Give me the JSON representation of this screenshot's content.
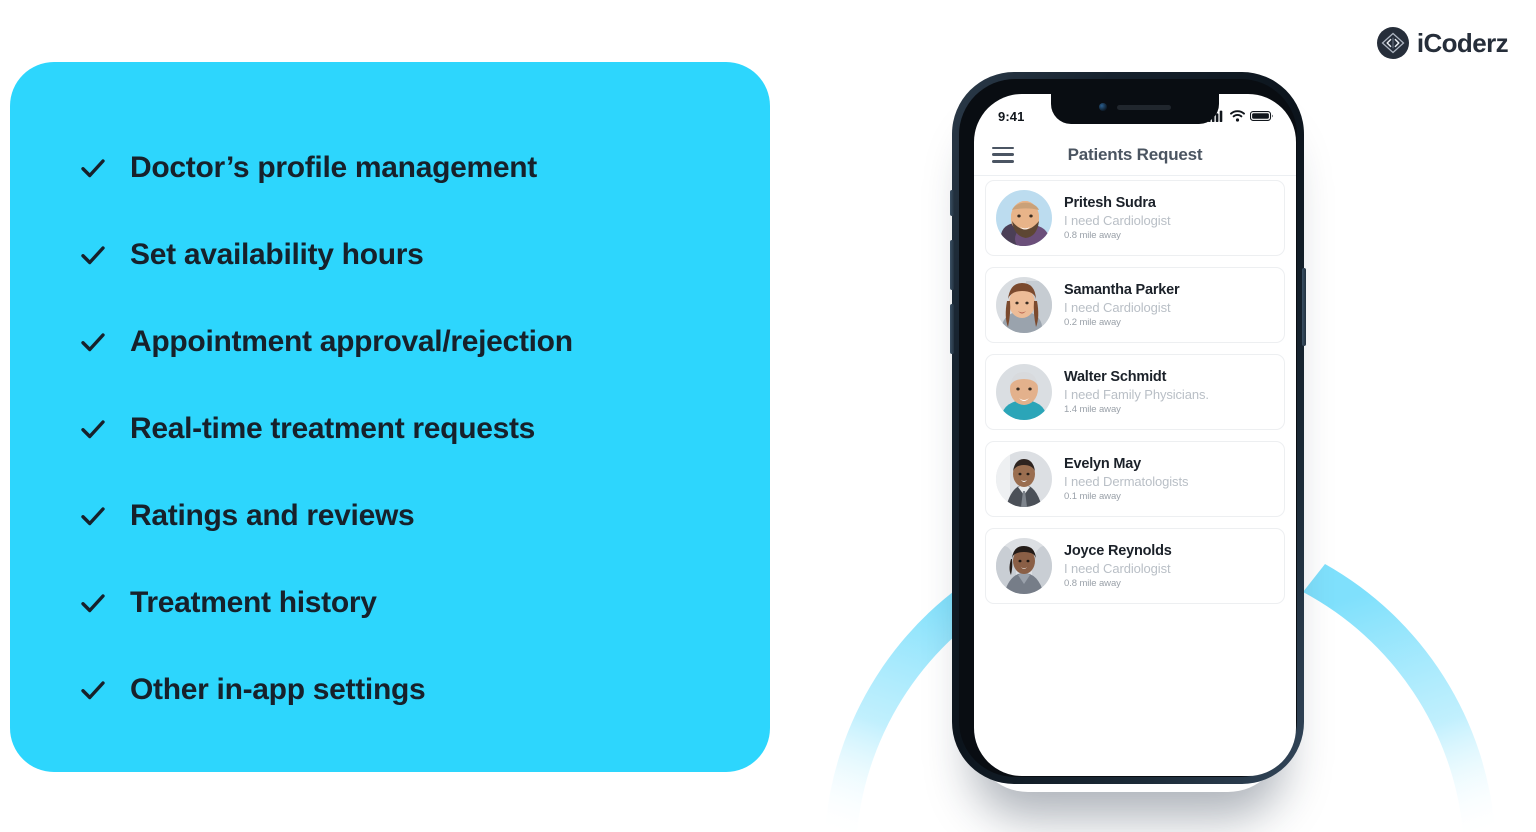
{
  "brand": {
    "name": "iCoderz",
    "mark_icon": "icoderz-diamond-icon",
    "color": "#262e3a"
  },
  "features_panel": {
    "background_color": "#2DD6FD",
    "text_color": "#17212b",
    "check_icon": "check-icon",
    "items": [
      {
        "label": "Doctor’s profile management"
      },
      {
        "label": "Set availability hours"
      },
      {
        "label": "Appointment approval/rejection"
      },
      {
        "label": "Real-time treatment requests"
      },
      {
        "label": "Ratings and reviews"
      },
      {
        "label": "Treatment history"
      },
      {
        "label": "Other in-app settings"
      }
    ]
  },
  "decor": {
    "arc_color": "#8FE5FD"
  },
  "phone": {
    "frame_color": "#16222e",
    "status_bar": {
      "time": "9:41",
      "icons": [
        "signal-icon",
        "wifi-icon",
        "battery-icon"
      ]
    },
    "app_bar": {
      "menu_icon": "hamburger-menu-icon",
      "title": "Patients Request"
    },
    "patients": [
      {
        "name": "Pritesh Sudra",
        "need": "I need Cardiologist",
        "distance": "0.8 mile away",
        "avatar_bg": "#bcdcef",
        "avatar_tone": "#d9a87e"
      },
      {
        "name": "Samantha Parker",
        "need": "I need Cardiologist",
        "distance": "0.2 mile away",
        "avatar_bg": "#d9dde1",
        "avatar_tone": "#e3b293"
      },
      {
        "name": "Walter Schmidt",
        "need": "I need Family Physicians.",
        "distance": "1.4 mile away",
        "avatar_bg": "#dadee2",
        "avatar_tone": "#d8a98c"
      },
      {
        "name": "Evelyn May",
        "need": "I need Dermatologists",
        "distance": "0.1 mile away",
        "avatar_bg": "#dcdfe3",
        "avatar_tone": "#8d6a55"
      },
      {
        "name": "Joyce Reynolds",
        "need": "I need Cardiologist",
        "distance": "0.8 mile away",
        "avatar_bg": "#dcdfe3",
        "avatar_tone": "#8a5f46"
      }
    ]
  }
}
